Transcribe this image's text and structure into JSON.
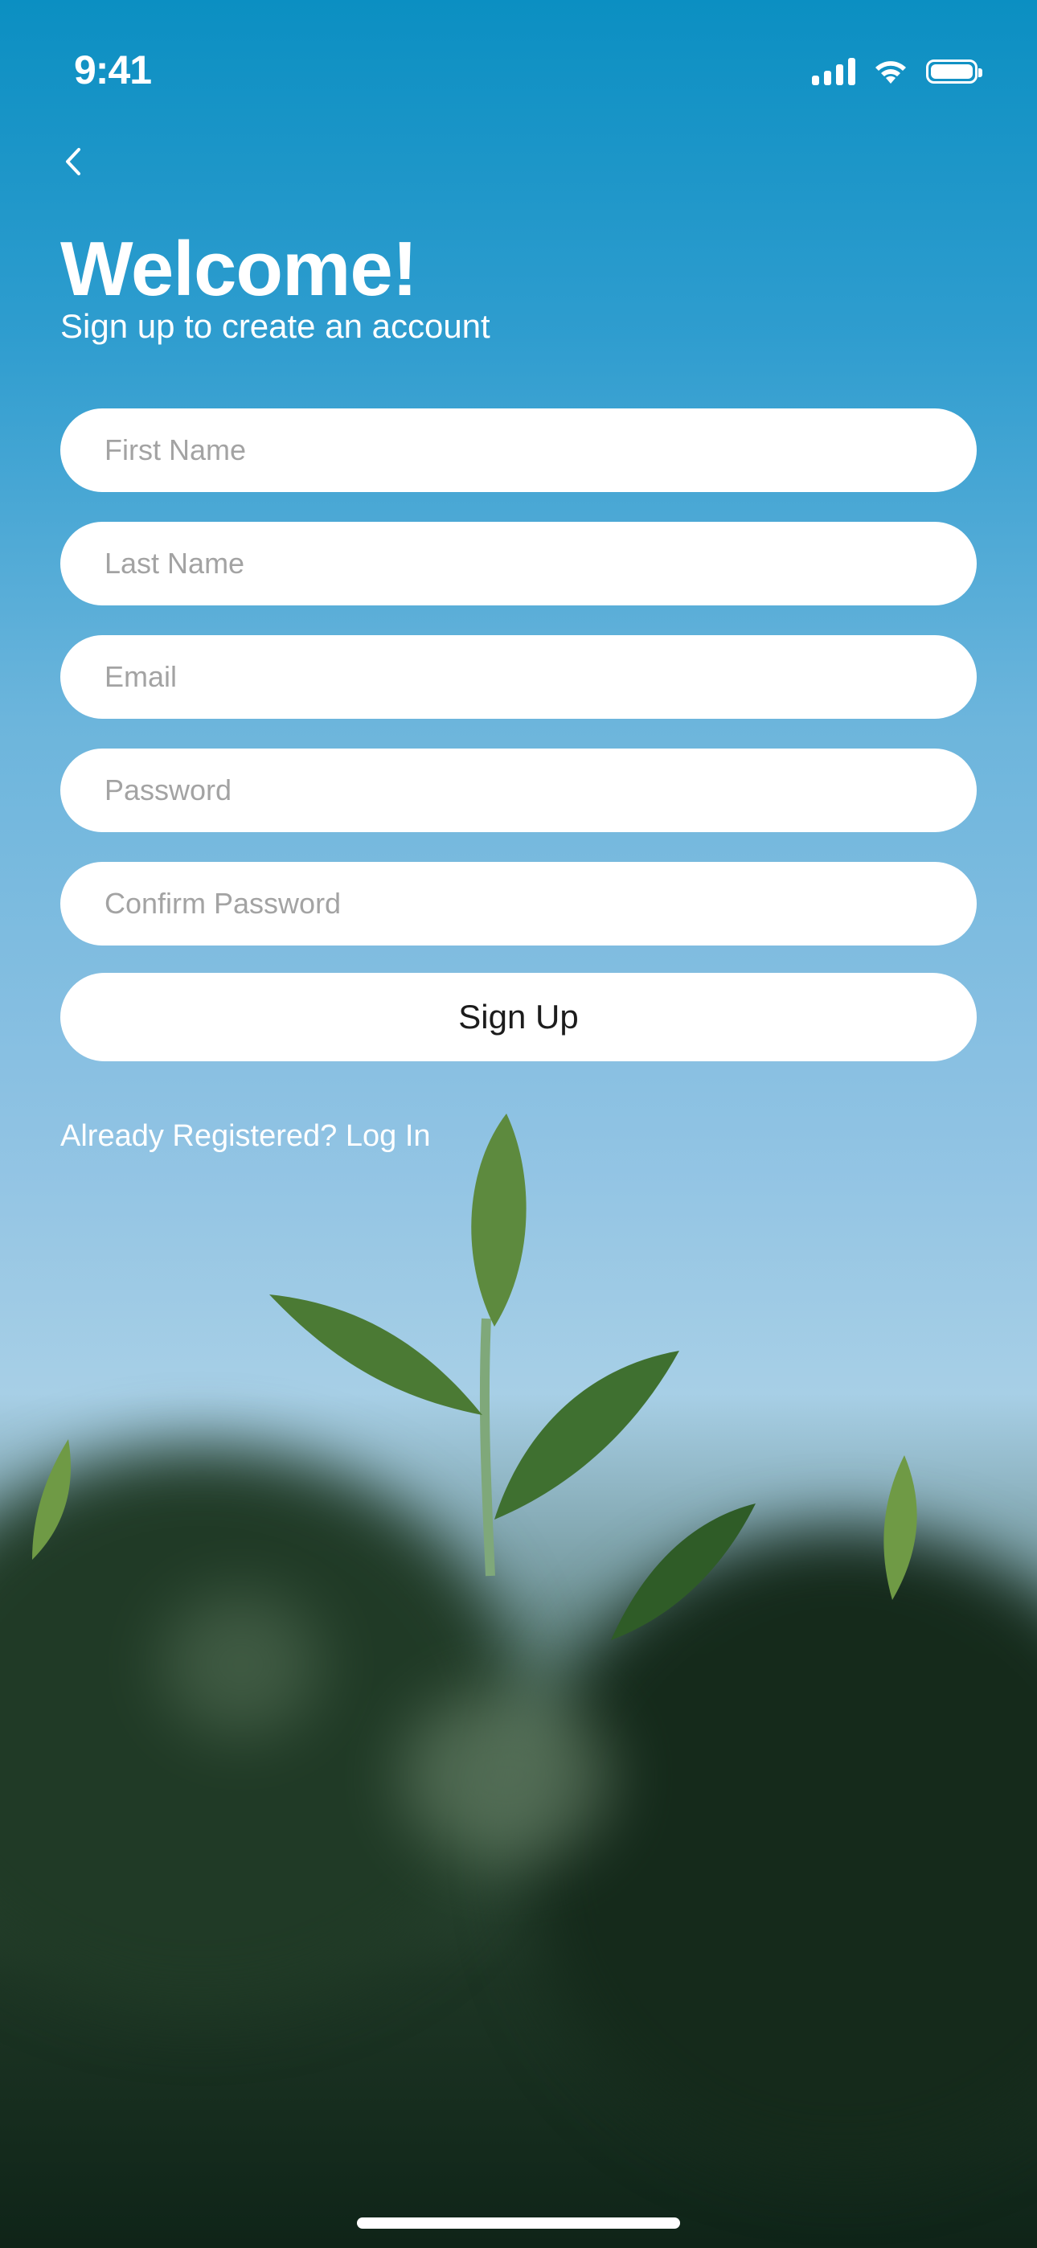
{
  "status_bar": {
    "time": "9:41"
  },
  "header": {
    "back_icon": "chevron-left-icon",
    "title": "Welcome!",
    "subtitle": "Sign up to create an account"
  },
  "form": {
    "first_name": {
      "placeholder": "First Name",
      "value": ""
    },
    "last_name": {
      "placeholder": "Last Name",
      "value": ""
    },
    "email": {
      "placeholder": "Email",
      "value": ""
    },
    "password": {
      "placeholder": "Password",
      "value": ""
    },
    "confirm_password": {
      "placeholder": "Confirm Password",
      "value": ""
    },
    "submit_label": "Sign Up"
  },
  "footer": {
    "login_link": "Already Registered? Log In"
  },
  "colors": {
    "sky_top": "#0b8fc2",
    "sky_mid": "#8ec2e3",
    "foliage": "#1d3524",
    "field_bg": "#ffffff",
    "placeholder": "#a3a3a3",
    "text_light": "#ffffff"
  }
}
